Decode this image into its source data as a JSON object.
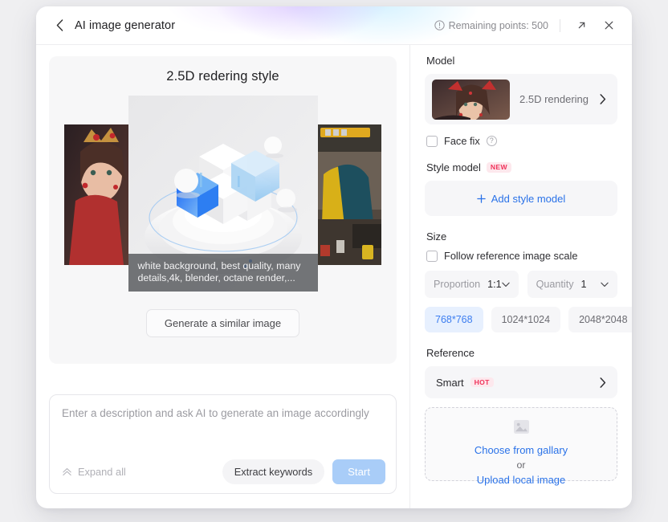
{
  "header": {
    "back_icon": "chevron-left-icon",
    "title": "AI image generator",
    "points_icon": "info-circle-icon",
    "points_label": "Remaining points: 500",
    "expand_icon": "external-link-icon",
    "close_icon": "close-icon"
  },
  "preview": {
    "title": "2.5D redering style",
    "caption": "white background, best quality, many details,4k, blender, octane render,...",
    "generate_similar_label": "Generate a similar image"
  },
  "prompt": {
    "placeholder": "Enter a description and ask AI to generate an image accordingly",
    "value": "",
    "expand_icon": "chevron-double-up-icon",
    "expand_label": "Expand all",
    "extract_label": "Extract keywords",
    "start_label": "Start"
  },
  "sidebar": {
    "model": {
      "label": "Model",
      "thumb_name": "model-thumbnail",
      "selected": "2.5D rendering",
      "chevron_icon": "chevron-right-icon",
      "face_fix_label": "Face fix",
      "face_fix_checked": false,
      "help_icon": "question-mark-icon"
    },
    "style_model": {
      "label": "Style model",
      "badge": "NEW",
      "add_label": "Add style model",
      "plus_icon": "plus-icon"
    },
    "size": {
      "label": "Size",
      "follow_label": "Follow reference image scale",
      "follow_checked": false,
      "proportion_label": "Proportion",
      "proportion_value": "1:1",
      "quantity_label": "Quantity",
      "quantity_value": "1",
      "caret_icon": "chevron-down-icon",
      "options": [
        "768*768",
        "1024*1024",
        "2048*2048"
      ],
      "selected_option": "768*768"
    },
    "reference": {
      "label": "Reference",
      "smart_label": "Smart",
      "smart_badge": "HOT",
      "chevron_icon": "chevron-right-icon",
      "upload_icon": "image-placeholder-icon",
      "gallery_label": "Choose from gallary",
      "or_label": "or",
      "upload_label": "Upload local image"
    }
  },
  "colors": {
    "accent_blue": "#2a72e8",
    "chip_active_bg": "#e7f0fe",
    "chip_active_text": "#3d7ef0",
    "badge_pink": "#f0325a",
    "start_disabled": "#a9cdf8"
  }
}
